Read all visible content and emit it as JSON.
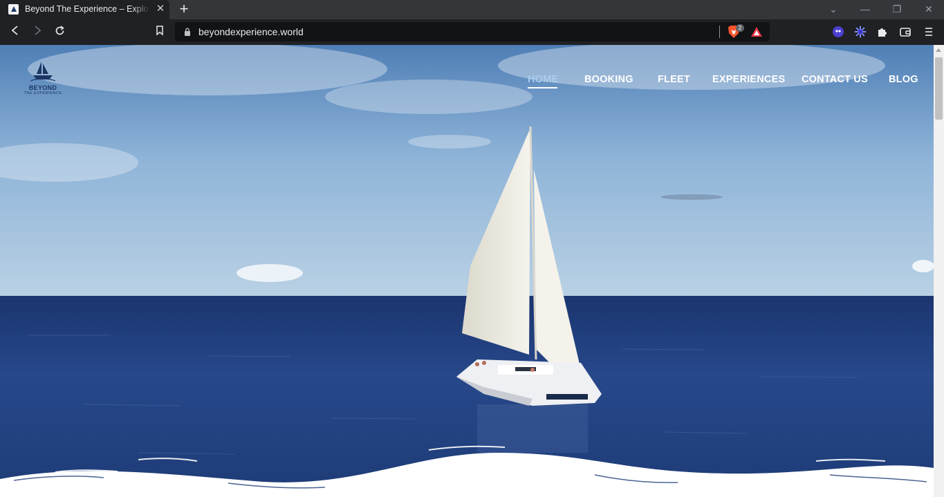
{
  "browser": {
    "tab_title": "Beyond The Experience – Explore",
    "new_tab": "+",
    "url": "beyondexperience.world",
    "shields_count": "2"
  },
  "site": {
    "logo_line1": "BEYOND",
    "logo_line2": "THE EXPERIENCE",
    "nav": [
      "HOME",
      "BOOKING",
      "FLEET",
      "EXPERIENCES",
      "CONTACT US",
      "BLOG"
    ],
    "active_nav": "HOME"
  },
  "colors": {
    "chrome_dark": "#202124",
    "tab_strip": "#35363a",
    "brand_navy": "#1c3663",
    "sky": "#7aa6d0",
    "sea": "#1f3d78"
  }
}
